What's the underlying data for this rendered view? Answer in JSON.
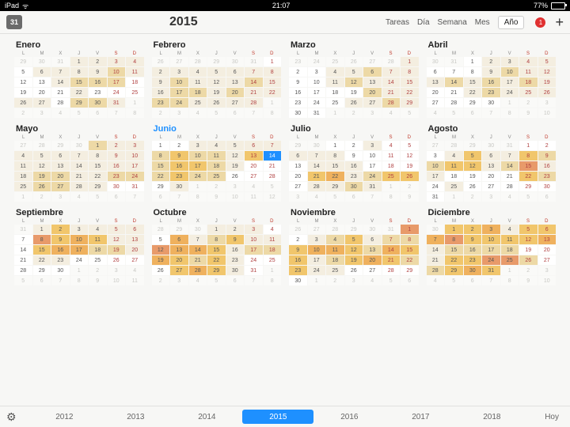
{
  "statusbar": {
    "device": "iPad",
    "time": "21:07",
    "battery_pct": "77%",
    "battery_fill": 77
  },
  "toolbar": {
    "icon_text": "31",
    "year": "2015",
    "tabs": [
      "Tareas",
      "Día",
      "Semana",
      "Mes",
      "Año"
    ],
    "selected_tab_index": 4,
    "notif_count": "1"
  },
  "dow": [
    "L",
    "M",
    "X",
    "J",
    "V",
    "S",
    "D"
  ],
  "current_month_index": 5,
  "months": [
    {
      "name": "Enero",
      "lead": 3,
      "len": 31,
      "heat": {
        "1": 1,
        "2": 1,
        "3": 1,
        "4": 1,
        "6": 1,
        "7": 1,
        "8": 1,
        "9": 1,
        "10": 2,
        "11": 1,
        "14": 1,
        "15": 2,
        "16": 2,
        "17": 2,
        "22": 1,
        "26": 1,
        "27": 1,
        "29": 2,
        "30": 2,
        "31": 1
      }
    },
    {
      "name": "Febrero",
      "lead": 6,
      "len": 28,
      "heat": {
        "2": 1,
        "3": 1,
        "4": 1,
        "5": 1,
        "6": 1,
        "7": 1,
        "8": 1,
        "9": 1,
        "10": 2,
        "11": 1,
        "12": 1,
        "13": 1,
        "14": 2,
        "15": 1,
        "16": 1,
        "17": 2,
        "18": 2,
        "19": 1,
        "20": 2,
        "21": 1,
        "22": 1,
        "23": 2,
        "24": 2,
        "25": 1,
        "26": 1,
        "27": 1,
        "28": 1
      }
    },
    {
      "name": "Marzo",
      "lead": 6,
      "len": 31,
      "heat": {
        "1": 1,
        "4": 1,
        "5": 1,
        "6": 2,
        "7": 1,
        "8": 1,
        "11": 1,
        "12": 2,
        "13": 1,
        "14": 1,
        "15": 1,
        "20": 2,
        "21": 1,
        "22": 1,
        "26": 1,
        "27": 1,
        "28": 2,
        "29": 1
      }
    },
    {
      "name": "Abril",
      "lead": 2,
      "len": 30,
      "heat": {
        "2": 1,
        "3": 1,
        "4": 1,
        "5": 1,
        "9": 1,
        "10": 2,
        "11": 1,
        "12": 1,
        "13": 1,
        "14": 2,
        "15": 1,
        "16": 2,
        "17": 1,
        "18": 2,
        "19": 1,
        "22": 1,
        "23": 2,
        "24": 1,
        "25": 1,
        "26": 1
      }
    },
    {
      "name": "Mayo",
      "lead": 4,
      "len": 31,
      "heat": {
        "1": 2,
        "2": 1,
        "3": 1,
        "4": 1,
        "5": 1,
        "6": 1,
        "7": 1,
        "8": 1,
        "9": 1,
        "10": 1,
        "11": 1,
        "12": 1,
        "13": 1,
        "14": 1,
        "15": 1,
        "16": 1,
        "17": 1,
        "18": 1,
        "19": 2,
        "20": 2,
        "21": 1,
        "22": 1,
        "23": 2,
        "24": 2,
        "25": 1,
        "26": 2,
        "27": 2,
        "28": 1,
        "29": 1
      }
    },
    {
      "name": "Junio",
      "lead": 0,
      "len": 30,
      "heat": {
        "3": 1,
        "4": 1,
        "5": 1,
        "6": 1,
        "7": 1,
        "8": 2,
        "9": 3,
        "10": 2,
        "11": 2,
        "12": 1,
        "13": 3,
        "15": 2,
        "16": 3,
        "17": 3,
        "18": 2,
        "19": 1,
        "22": 2,
        "23": 3,
        "24": 2,
        "25": 2,
        "30": 1
      },
      "today": 14
    },
    {
      "name": "Julio",
      "lead": 2,
      "len": 31,
      "heat": {
        "3": 1,
        "6": 1,
        "7": 1,
        "8": 1,
        "14": 1,
        "15": 1,
        "16": 1,
        "21": 3,
        "22": 4,
        "23": 1,
        "24": 2,
        "25": 3,
        "26": 3,
        "28": 1,
        "29": 1,
        "30": 2,
        "31": 1
      }
    },
    {
      "name": "Agosto",
      "lead": 5,
      "len": 31,
      "heat": {
        "4": 1,
        "5": 3,
        "6": 1,
        "7": 1,
        "8": 3,
        "9": 2,
        "10": 2,
        "11": 3,
        "12": 3,
        "13": 1,
        "14": 2,
        "15": 5,
        "16": 1,
        "17": 1,
        "22": 3,
        "23": 2,
        "25": 1
      }
    },
    {
      "name": "Septiembre",
      "lead": 1,
      "len": 30,
      "heat": {
        "1": 1,
        "2": 3,
        "3": 1,
        "4": 1,
        "5": 1,
        "6": 1,
        "8": 5,
        "9": 3,
        "10": 4,
        "11": 3,
        "12": 1,
        "13": 1,
        "15": 3,
        "16": 4,
        "17": 4,
        "18": 2,
        "19": 2,
        "20": 1,
        "22": 1,
        "23": 1
      }
    },
    {
      "name": "Octubre",
      "lead": 3,
      "len": 31,
      "heat": {
        "1": 1,
        "2": 1,
        "3": 1,
        "6": 4,
        "7": 1,
        "8": 2,
        "9": 3,
        "10": 1,
        "11": 1,
        "12": 5,
        "13": 4,
        "14": 4,
        "15": 3,
        "16": 1,
        "17": 2,
        "18": 2,
        "19": 4,
        "20": 3,
        "21": 2,
        "22": 3,
        "23": 1,
        "27": 3,
        "28": 4,
        "29": 3,
        "30": 1
      }
    },
    {
      "name": "Noviembre",
      "lead": 6,
      "len": 30,
      "heat": {
        "1": 5,
        "3": 1,
        "4": 2,
        "5": 3,
        "6": 1,
        "7": 2,
        "8": 2,
        "9": 3,
        "10": 4,
        "11": 4,
        "12": 3,
        "13": 2,
        "14": 4,
        "15": 3,
        "16": 3,
        "17": 1,
        "18": 2,
        "19": 3,
        "20": 4,
        "21": 3,
        "22": 2,
        "23": 3,
        "24": 1,
        "25": 1
      }
    },
    {
      "name": "Diciembre",
      "lead": 1,
      "len": 31,
      "heat": {
        "1": 3,
        "2": 3,
        "3": 4,
        "4": 1,
        "5": 3,
        "6": 3,
        "7": 4,
        "8": 5,
        "9": 3,
        "10": 3,
        "11": 3,
        "12": 3,
        "13": 4,
        "14": 1,
        "15": 2,
        "16": 2,
        "17": 2,
        "18": 2,
        "21": 1,
        "22": 3,
        "23": 3,
        "24": 5,
        "25": 5,
        "26": 2,
        "28": 2,
        "29": 3,
        "30": 4,
        "31": 3
      }
    }
  ],
  "footer": {
    "years": [
      "2012",
      "2013",
      "2014",
      "2015",
      "2016",
      "2017",
      "2018"
    ],
    "selected_year_index": 3,
    "today_label": "Hoy"
  }
}
